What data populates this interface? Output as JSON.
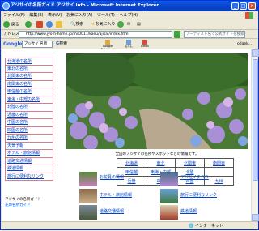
{
  "window": {
    "title": "アジサイの名所ガイド アジサイ.info - Microsoft Internet Explorer"
  },
  "menu": [
    "ファイル(F)",
    "編集(E)",
    "表示(V)",
    "お気に入り(A)",
    "ツール(T)",
    "ヘルプ(H)"
  ],
  "toolbar": {
    "back": "戻る",
    "search": "検索",
    "favorites": "お気に入り"
  },
  "address": {
    "label": "アドレス(D)",
    "url": "http://www.jyo-h-home.jp/ms0011/kaeu/ajisai/index.htm",
    "search_placeholder": "アーティスト名で公式サイトを検索"
  },
  "google": {
    "logo": "Google",
    "query": "アジサイ 名所",
    "search_btn": "検索",
    "btn_labels": [
      "Google Notebook",
      "友人に",
      "Gmail",
      "odaek..."
    ]
  },
  "nav": [
    "北海道の名所",
    "東北の名所",
    "北関東の名所",
    "南関東の名所",
    "甲信越の名所",
    "東海・中部の名所",
    "北陸の名所",
    "近畿の名所",
    "中国の名所",
    "四国の名所",
    "九州の名所",
    "天気予報",
    "ホテル・旅館情報",
    "道路交通情報",
    "鉄道情報",
    "旅行に便利なリンク"
  ],
  "nav_foot": {
    "line1": "アジサイの名所ガイド",
    "line2": "花の名所ガイド"
  },
  "intro": "全国のアジサイの名所やスポットなどの情報です。",
  "regions": [
    [
      "北海道",
      "東北",
      "北関東",
      "南関東"
    ],
    [
      "甲信越",
      "東海・中部",
      "北陸",
      ""
    ],
    [
      "近畿",
      "中国",
      "四国",
      "九州"
    ]
  ],
  "tiles": [
    {
      "label": "お花見の情報"
    },
    {
      "label": "アジサイまつり"
    },
    {
      "label": "ホテル・旅館情報"
    },
    {
      "label": "旅行に便利なリンク"
    },
    {
      "label": "道路交通情報"
    },
    {
      "label": "鉄道情報"
    }
  ],
  "status": {
    "zone": "インターネット"
  },
  "colors": {
    "title_bar": "#0842c8",
    "nav_border": "#d27f8f",
    "link": "#0044cc"
  }
}
